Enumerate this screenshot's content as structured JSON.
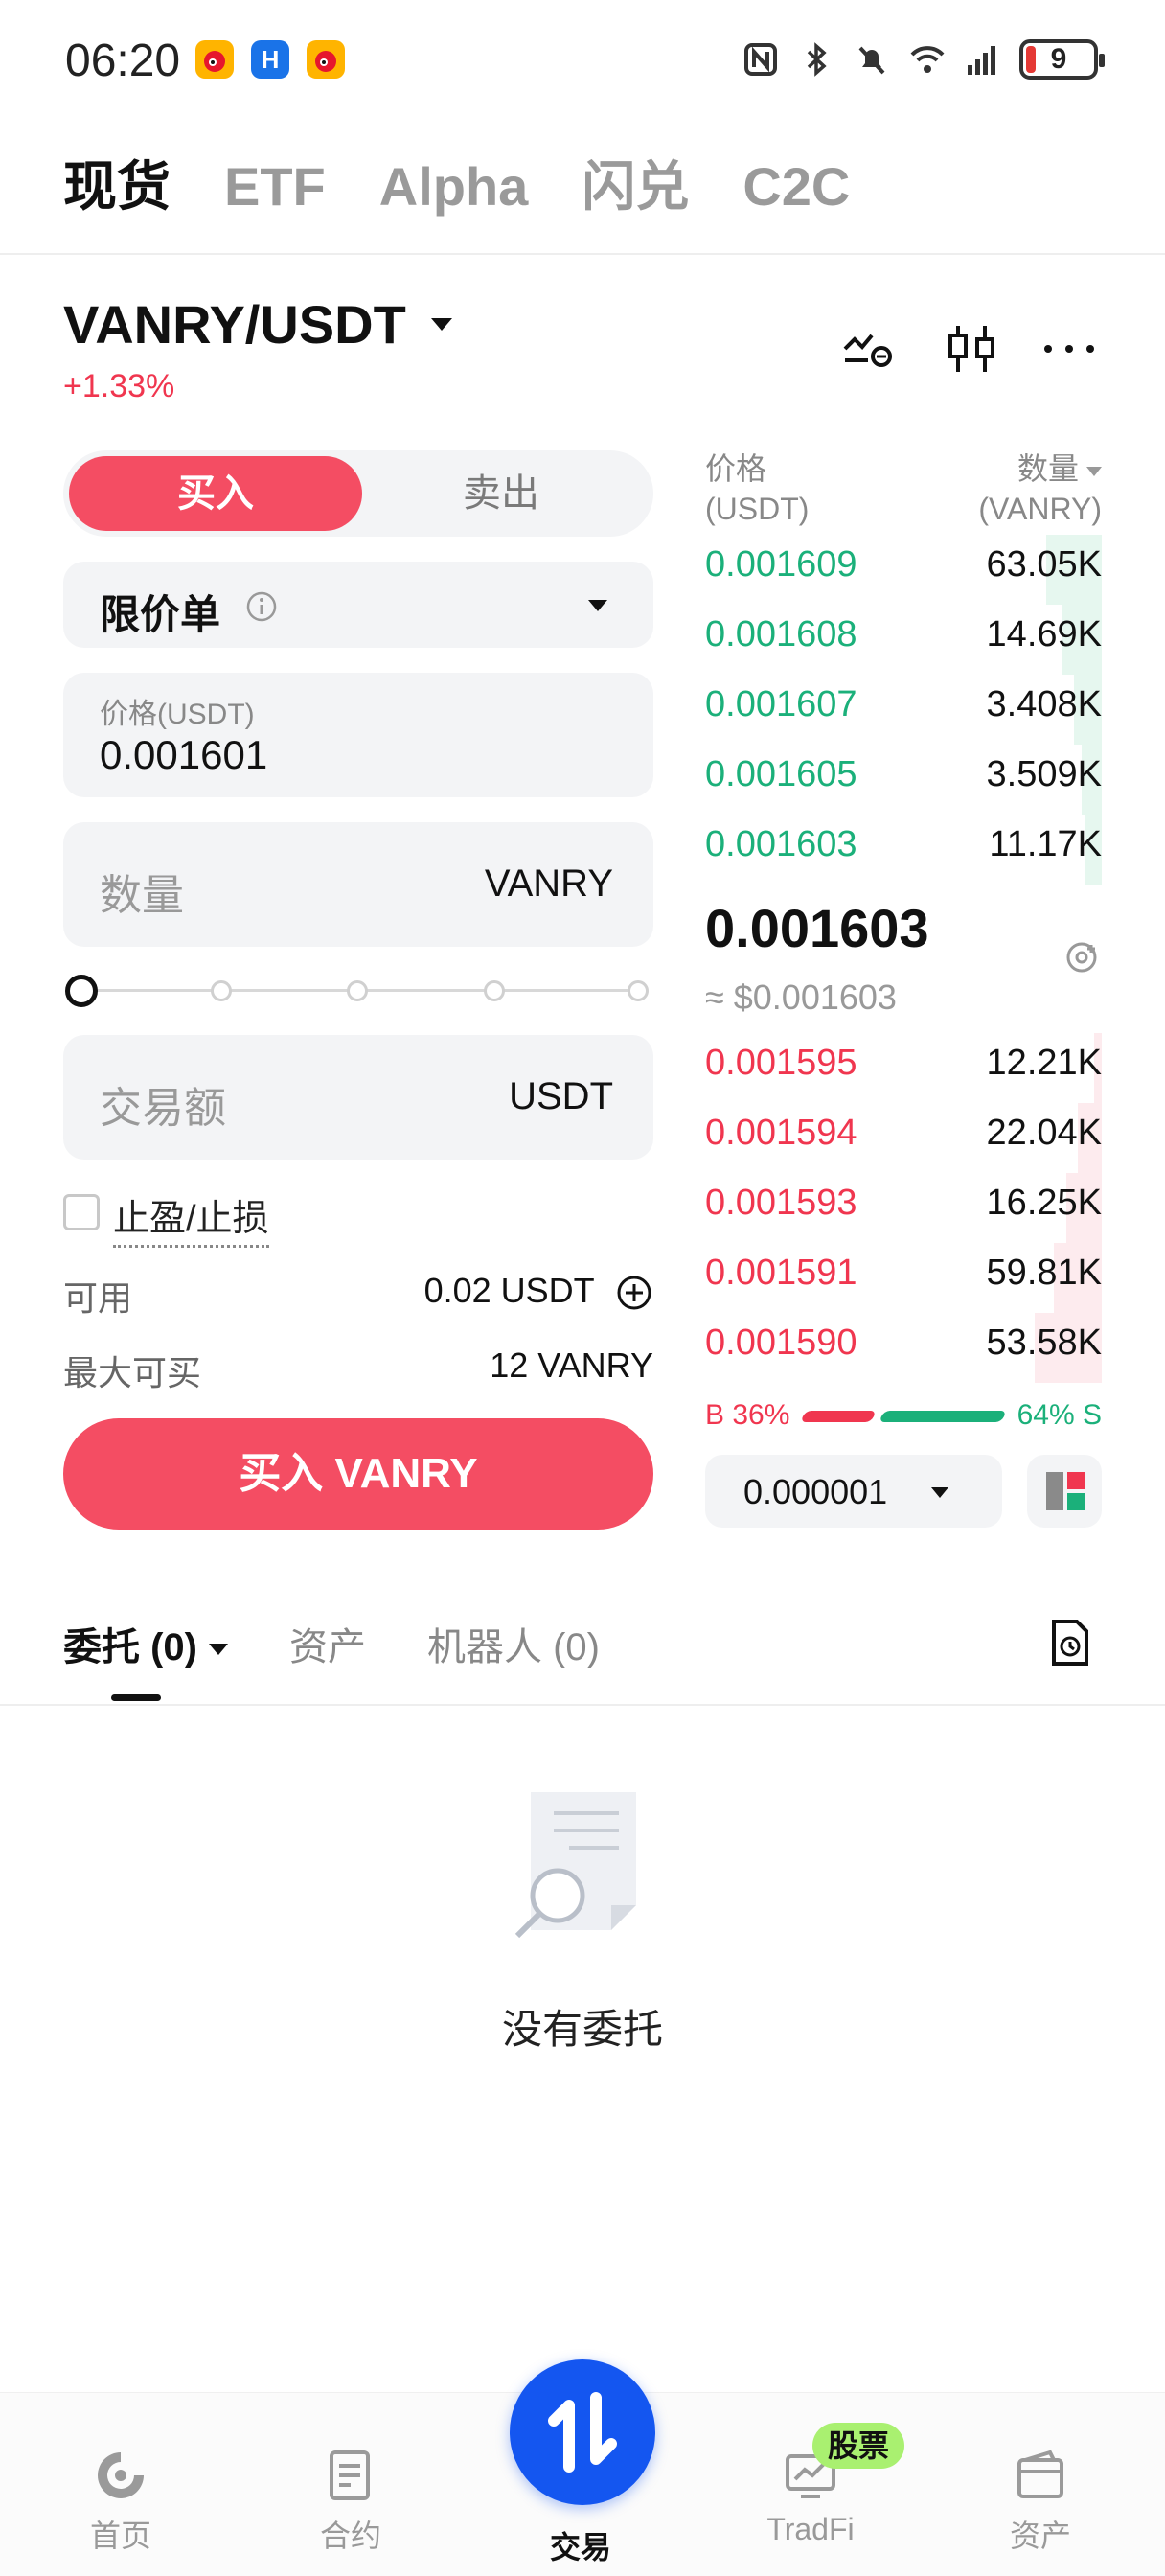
{
  "status_bar": {
    "time": "06:20",
    "battery": "9",
    "icons": [
      "weibo-icon",
      "app-icon",
      "weibo-icon",
      "nfc-icon",
      "bluetooth-icon",
      "mute-icon",
      "wifi-icon",
      "signal-icon",
      "battery-icon"
    ]
  },
  "top_tabs": [
    "现货",
    "ETF",
    "Alpha",
    "闪兑",
    "C2C"
  ],
  "pair": {
    "symbol": "VANRY/USDT",
    "change": "+1.33%"
  },
  "side": {
    "buy": "买入",
    "sell": "卖出"
  },
  "order_type": {
    "label": "限价单"
  },
  "price_field": {
    "label": "价格(USDT)",
    "value": "0.001601"
  },
  "qty_field": {
    "placeholder": "数量",
    "unit": "VANRY"
  },
  "amount_field": {
    "placeholder": "交易额",
    "unit": "USDT"
  },
  "tpsl": {
    "label": "止盈/止损"
  },
  "available": {
    "label": "可用",
    "value": "0.02 USDT"
  },
  "max_buy": {
    "label": "最大可买",
    "value": "12 VANRY"
  },
  "buy_button": "买入 VANRY",
  "orderbook": {
    "price_header": "价格",
    "price_unit": "(USDT)",
    "qty_header": "数量",
    "qty_unit": "(VANRY)",
    "asks": [
      {
        "price": "0.001609",
        "qty": "63.05K",
        "depth": 0.14
      },
      {
        "price": "0.001608",
        "qty": "14.69K",
        "depth": 0.1
      },
      {
        "price": "0.001607",
        "qty": "3.408K",
        "depth": 0.07
      },
      {
        "price": "0.001605",
        "qty": "3.509K",
        "depth": 0.05
      },
      {
        "price": "0.001603",
        "qty": "11.17K",
        "depth": 0.04
      }
    ],
    "last_price": "0.001603",
    "last_usd": "≈ $0.001603",
    "bids": [
      {
        "price": "0.001595",
        "qty": "12.21K",
        "depth": 0.02
      },
      {
        "price": "0.001594",
        "qty": "22.04K",
        "depth": 0.06
      },
      {
        "price": "0.001593",
        "qty": "16.25K",
        "depth": 0.09
      },
      {
        "price": "0.001591",
        "qty": "59.81K",
        "depth": 0.12
      },
      {
        "price": "0.001590",
        "qty": "53.58K",
        "depth": 0.17
      }
    ],
    "buy_ratio": "B 36%",
    "sell_ratio": "64% S",
    "tick_size": "0.000001"
  },
  "orders_tabs": {
    "orders": "委托 (0)",
    "assets": "资产",
    "bots": "机器人 (0)"
  },
  "empty": {
    "text": "没有委托"
  },
  "bottom_nav": {
    "home": "首页",
    "futures": "合约",
    "trade": "交易",
    "tradfi": "TradFi",
    "assets": "资产",
    "badge": "股票"
  },
  "colors": {
    "buy": "#f44d63",
    "sell": "#1bb07a",
    "accent": "#1456f0"
  }
}
